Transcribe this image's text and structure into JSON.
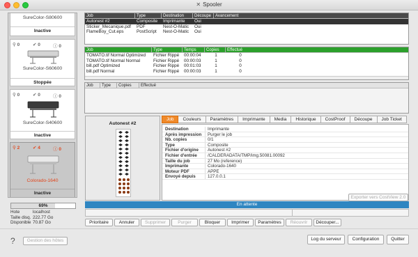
{
  "window": {
    "title": "Spooler"
  },
  "printers": [
    {
      "name": "SureColor-S80600",
      "status": "Inactive",
      "counts": null
    },
    {
      "name": "SureColor-S60600",
      "status": "Stoppée",
      "counts": [
        "0",
        "0",
        "0"
      ]
    },
    {
      "name": "SureColor-S40600",
      "status": "Inactive",
      "counts": [
        "0",
        "0",
        "0"
      ]
    },
    {
      "name": "Colorado-1640",
      "status": "Inactive",
      "counts": [
        "2",
        "4",
        "0"
      ]
    }
  ],
  "host": {
    "progress_label": "69%",
    "progress_value": 0.69,
    "rows": [
      {
        "key": "Hote",
        "value": "localhost"
      },
      {
        "key": "Taille disq.",
        "value": "222.77 Go"
      },
      {
        "key": "Disponible",
        "value": "70.87 Go"
      }
    ]
  },
  "queue_table": {
    "headers": [
      "Job",
      "Type",
      "Destination",
      "Découpe",
      "Avancement"
    ],
    "rows": [
      [
        "Autonest #2",
        "Composite",
        "Imprimante",
        "Oui",
        ""
      ],
      [
        "Sticker_Mecanique.pdf",
        "PDF",
        "Nest-O-Matic",
        "Oui",
        ""
      ],
      [
        "FlameBoy_Cut.eps",
        "PostScript",
        "Nest-O-Matic",
        "Oui",
        ""
      ]
    ]
  },
  "done_table": {
    "headers": [
      "Job",
      "Type",
      "Temps",
      "Copies",
      "Effectué"
    ],
    "rows": [
      [
        "TOMATO.tif Normal Optimized",
        "Fichier Rippé",
        "00:00:04",
        "1",
        "0"
      ],
      [
        "TOMATO.tif Normal Normal",
        "Fichier Rippé",
        "00:00:03",
        "1",
        "0"
      ],
      [
        "bill.pdf Optimized",
        "Fichier Rippé",
        "00:01:03",
        "1",
        "0"
      ],
      [
        "bill.pdf Normal",
        "Fichier Rippé",
        "00:00:03",
        "1",
        "0"
      ]
    ]
  },
  "cut_table": {
    "headers": [
      "Job",
      "Type",
      "Copies",
      "Effectué"
    ]
  },
  "preview": {
    "title": "Autonest #2"
  },
  "tabs": [
    "Job",
    "Couleurs",
    "Paramètres",
    "Imprimante",
    "Media",
    "Historique",
    "CostProof",
    "Découpe",
    "Job Ticket"
  ],
  "properties": [
    {
      "key": "Destination",
      "value": "Imprimante"
    },
    {
      "key": "Après impression",
      "value": "Purger le job"
    },
    {
      "key": "Nb. copies",
      "value": "0/1"
    },
    {
      "key": "Type",
      "value": "Composite"
    },
    {
      "key": "Fichier d'origine",
      "value": "Autonest #2"
    },
    {
      "key": "Fichier d'entrée",
      "value": "/CALDERADATA/TMP/img.50081.00092"
    },
    {
      "key": "Taille du job",
      "value": "27 Mo (reference)"
    },
    {
      "key": "Imprimante",
      "value": "Colorado-1640"
    },
    {
      "key": "Moteur PDF",
      "value": "APPE"
    },
    {
      "key": "Envoyé depuis",
      "value": "127.0.0.1"
    }
  ],
  "export_button": "Exporter vers CostView 2.0",
  "status": "En attente",
  "actions": [
    "Prioritaire",
    "Annuler",
    "Supprimer",
    "Purger",
    "Bloquer",
    "Imprimer",
    "Paramètres",
    "Réouvrir",
    "Découper..."
  ],
  "actions_disabled": [
    false,
    false,
    true,
    true,
    false,
    false,
    false,
    true,
    false
  ],
  "bottom": {
    "help": "?",
    "hosts_button": "Gestion des hôtes",
    "log_button": "Log du serveur",
    "config_button": "Configuration",
    "quit_button": "Quitter"
  },
  "colors": {
    "accent_tab": "#f08a2a",
    "status_bar": "#2f86c1",
    "error": "#e2451b",
    "done_header": "#2ca02c"
  }
}
